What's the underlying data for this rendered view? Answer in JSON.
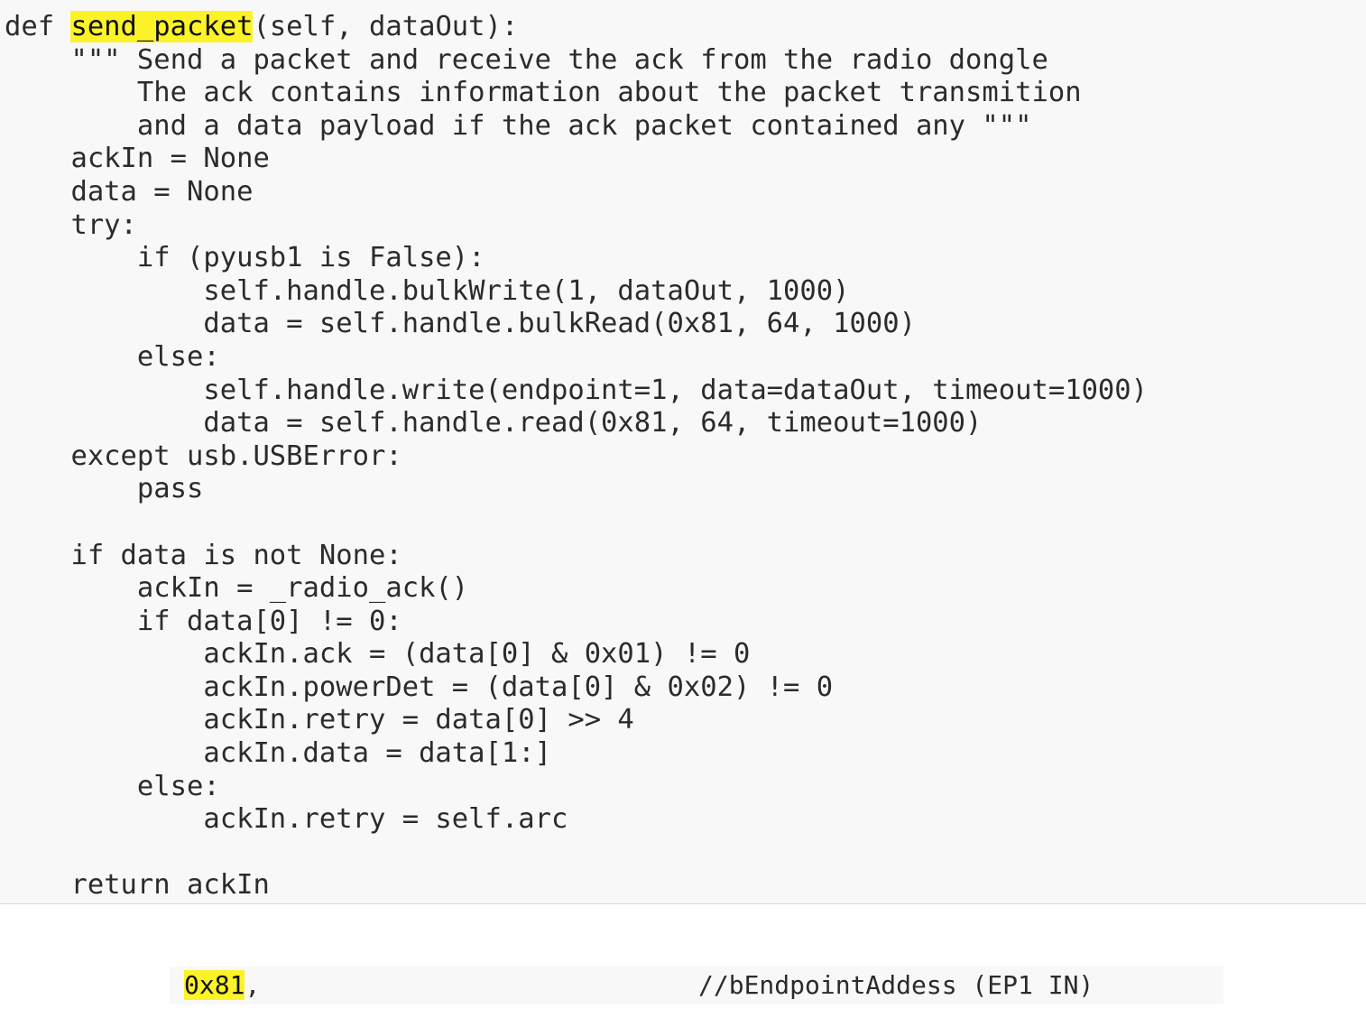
{
  "code": {
    "lines": [
      {
        "pre": "def ",
        "hl": "send_packet",
        "post": "(self, dataOut):"
      },
      {
        "text": "    \"\"\" Send a packet and receive the ack from the radio dongle"
      },
      {
        "text": "        The ack contains information about the packet transmition"
      },
      {
        "text": "        and a data payload if the ack packet contained any \"\"\""
      },
      {
        "text": "    ackIn = None"
      },
      {
        "text": "    data = None"
      },
      {
        "text": "    try:"
      },
      {
        "text": "        if (pyusb1 is False):"
      },
      {
        "text": "            self.handle.bulkWrite(1, dataOut, 1000)"
      },
      {
        "text": "            data = self.handle.bulkRead(0x81, 64, 1000)"
      },
      {
        "text": "        else:"
      },
      {
        "text": "            self.handle.write(endpoint=1, data=dataOut, timeout=1000)"
      },
      {
        "text": "            data = self.handle.read(0x81, 64, timeout=1000)"
      },
      {
        "text": "    except usb.USBError:"
      },
      {
        "text": "        pass"
      },
      {
        "text": ""
      },
      {
        "text": "    if data is not None:"
      },
      {
        "text": "        ackIn = _radio_ack()"
      },
      {
        "text": "        if data[0] != 0:"
      },
      {
        "text": "            ackIn.ack = (data[0] & 0x01) != 0"
      },
      {
        "text": "            ackIn.powerDet = (data[0] & 0x02) != 0"
      },
      {
        "text": "            ackIn.retry = data[0] >> 4"
      },
      {
        "text": "            ackIn.data = data[1:]"
      },
      {
        "text": "        else:"
      },
      {
        "text": "            ackIn.retry = self.arc"
      },
      {
        "text": ""
      },
      {
        "text": "    return ackIn"
      }
    ]
  },
  "snippet": {
    "value": "0x81",
    "suffix": ",",
    "comment": "//bEndpointAddess (EP1 IN)"
  },
  "colors": {
    "highlight": "#fbf227",
    "code_background": "#f8f8f8",
    "text": "#2b2b2b"
  }
}
